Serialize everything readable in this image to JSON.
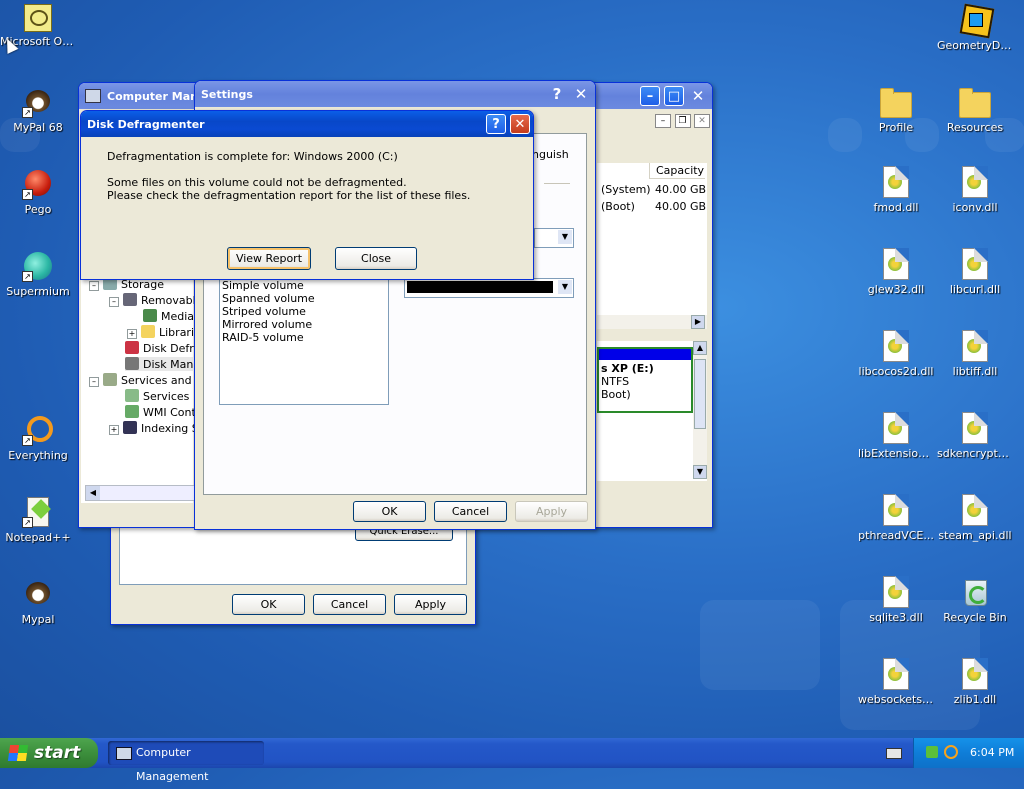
{
  "desktop": {
    "left_icons": [
      {
        "label": "Microsoft Outlook",
        "icon": "outlook-icon",
        "shortcut": false
      },
      {
        "label": "MyPal 68",
        "icon": "mypal-icon",
        "shortcut": true
      },
      {
        "label": "Pego",
        "icon": "pego-icon",
        "shortcut": true
      },
      {
        "label": "Supermium",
        "icon": "supermium-icon",
        "shortcut": true
      },
      {
        "label": "Everything",
        "icon": "everything-icon",
        "shortcut": true
      },
      {
        "label": "Notepad++",
        "icon": "notepadpp-icon",
        "shortcut": true
      },
      {
        "label": "Mypal",
        "icon": "mypal-icon",
        "shortcut": false
      }
    ],
    "right_icons": [
      {
        "label": "GeometryDash",
        "icon": "geometrydash-icon"
      },
      {
        "label": "Profile",
        "icon": "folder-icon"
      },
      {
        "label": "Resources",
        "icon": "folder-icon"
      },
      {
        "label": "fmod.dll",
        "icon": "dll-icon"
      },
      {
        "label": "iconv.dll",
        "icon": "dll-icon"
      },
      {
        "label": "glew32.dll",
        "icon": "dll-icon"
      },
      {
        "label": "libcurl.dll",
        "icon": "dll-icon"
      },
      {
        "label": "libcocos2d.dll",
        "icon": "dll-icon"
      },
      {
        "label": "libtiff.dll",
        "icon": "dll-icon"
      },
      {
        "label": "libExtensions...",
        "icon": "dll-icon"
      },
      {
        "label": "sdkencrypte...",
        "icon": "dll-icon"
      },
      {
        "label": "pthreadVCE...",
        "icon": "dll-icon"
      },
      {
        "label": "steam_api.dll",
        "icon": "dll-icon"
      },
      {
        "label": "sqlite3.dll",
        "icon": "dll-icon"
      },
      {
        "label": "Recycle Bin",
        "icon": "recycle-bin-icon"
      },
      {
        "label": "websockets.dll",
        "icon": "dll-icon"
      },
      {
        "label": "zlib1.dll",
        "icon": "dll-icon"
      }
    ]
  },
  "computer_management": {
    "title": "Computer Manag",
    "tree": [
      "Storage",
      "Removable",
      "Media",
      "Librarie",
      "Disk Defra",
      "Disk Manag",
      "Services and A",
      "Services",
      "WMI Contr",
      "Indexing S"
    ],
    "columns": {
      "capacity": "Capacity"
    },
    "rows": [
      {
        "status": "(System)",
        "capacity": "40.00 GB"
      },
      {
        "status": "(Boot)",
        "capacity": "40.00 GB"
      }
    ],
    "disk_label": {
      "line1": "s XP  (E:)",
      "line2": "NTFS",
      "line3": "Boot)"
    }
  },
  "back_dialog": {
    "buttons": {
      "ok": "OK",
      "cancel": "Cancel",
      "apply": "Apply"
    },
    "partial_button": "Quick Erase..."
  },
  "settings": {
    "title": "Settings",
    "help": "?",
    "close": "✕",
    "fragment_text": "nguish",
    "volume_types": [
      "Simple volume",
      "Spanned volume",
      "Striped volume",
      "Mirrored volume",
      "RAID-5 volume"
    ],
    "buttons": {
      "ok": "OK",
      "cancel": "Cancel",
      "apply": "Apply"
    }
  },
  "defrag": {
    "title": "Disk Defragmenter",
    "line1": "Defragmentation is complete for: Windows 2000 (C:)",
    "line2": "Some files on this volume could not be defragmented.",
    "line3": "Please check the defragmentation report for the list of these files.",
    "view_report": "View Report",
    "close": "Close"
  },
  "taskbar": {
    "start": "start",
    "item": "Computer Management",
    "time": "6:04 PM"
  }
}
